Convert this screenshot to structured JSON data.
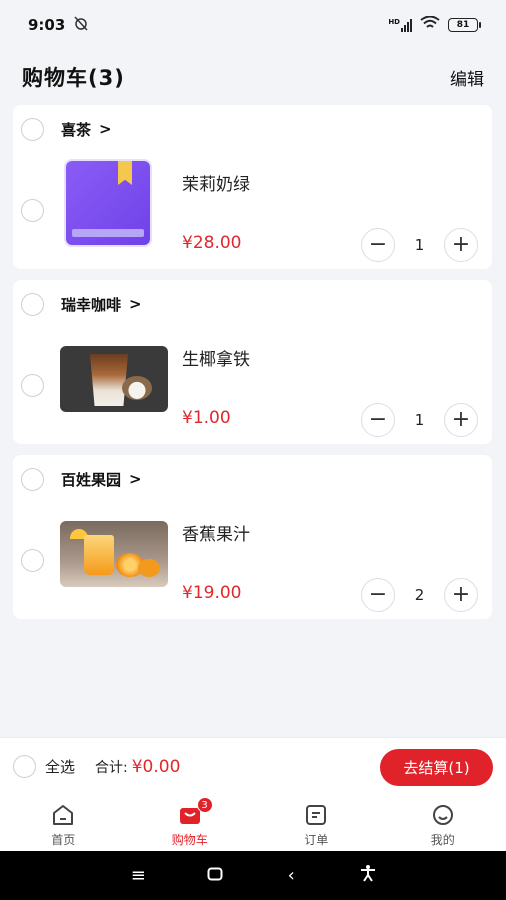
{
  "status": {
    "time": "9:03",
    "battery": "81",
    "network": "HD"
  },
  "header": {
    "title": "购物车(3)",
    "edit_label": "编辑"
  },
  "shops": [
    {
      "name": "喜茶",
      "chevron": ">",
      "item": {
        "name": "茉莉奶绿",
        "price": "¥28.00",
        "qty": "1",
        "image_icon": "book-icon"
      }
    },
    {
      "name": "瑞幸咖啡",
      "chevron": ">",
      "item": {
        "name": "生椰拿铁",
        "price": "¥1.00",
        "qty": "1",
        "image_icon": "coconut-latte-photo"
      }
    },
    {
      "name": "百姓果园",
      "chevron": ">",
      "item": {
        "name": "香蕉果汁",
        "price": "¥19.00",
        "qty": "2",
        "image_icon": "orange-juice-photo"
      }
    }
  ],
  "stepper": {
    "minus": "−",
    "plus": "+"
  },
  "checkout": {
    "select_all_label": "全选",
    "total_label": "合计:",
    "total_value": "¥0.00",
    "button_label": "去结算(1)"
  },
  "tabs": [
    {
      "label": "首页",
      "icon": "home-icon",
      "active": false
    },
    {
      "label": "购物车",
      "icon": "cart-icon",
      "active": true,
      "badge": "3"
    },
    {
      "label": "订单",
      "icon": "orders-icon",
      "active": false
    },
    {
      "label": "我的",
      "icon": "profile-icon",
      "active": false
    }
  ],
  "nav": {
    "menu": "≡",
    "home": "▢",
    "back": "‹",
    "accessibility": "accessibility-icon"
  },
  "colors": {
    "accent": "#e0232a",
    "price": "#e0282d",
    "background": "#f3f4f8"
  }
}
